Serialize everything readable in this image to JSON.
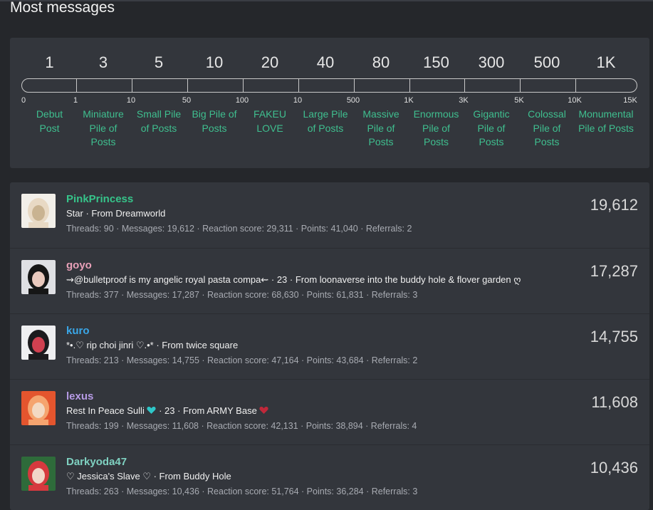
{
  "page": {
    "title": "Most messages"
  },
  "scale": {
    "levels": [
      "1",
      "3",
      "5",
      "10",
      "20",
      "40",
      "80",
      "150",
      "300",
      "500",
      "1K"
    ],
    "ticks": [
      "0",
      "1",
      "10",
      "50",
      "100",
      "10",
      "500",
      "1K",
      "3K",
      "5K",
      "10K",
      "15K"
    ],
    "trophies": [
      [
        "Debut",
        "Post"
      ],
      [
        "Miniature",
        "Pile of",
        "Posts"
      ],
      [
        "Small Pile",
        "of Posts"
      ],
      [
        "Big Pile of",
        "Posts"
      ],
      [
        "FAKEU",
        "LOVE"
      ],
      [
        "Large Pile",
        "of Posts"
      ],
      [
        "Massive",
        "Pile of",
        "Posts"
      ],
      [
        "Enormous",
        "Pile of",
        "Posts"
      ],
      [
        "Gigantic",
        "Pile of",
        "Posts"
      ],
      [
        "Colossal",
        "Pile of",
        "Posts"
      ],
      [
        "Monumental",
        "Pile of Posts"
      ]
    ],
    "trophy_color": "#3fbf8f"
  },
  "members": [
    {
      "name": "PinkPrincess",
      "name_color": "#36c48a",
      "title": "Star · From Dreamworld",
      "stats": "Threads: 90 · Messages: 19,612 · Reaction score: 29,311 · Points: 41,040 · Referrals: 2",
      "count": "19,612",
      "avatar_icon": "avatar-pinkprincess-icon",
      "avatar_colors": [
        "#f2efe9",
        "#e8d9c4",
        "#c9b391"
      ]
    },
    {
      "name": "goyo",
      "name_color": "#e8a0b8",
      "title": "⇝@bulletproof is my angelic royal pasta compa⇜ · 23 · From loonaverse into the buddy hole & flover garden ღ",
      "stats": "Threads: 377 · Messages: 17,287 · Reaction score: 68,630 · Points: 61,831 · Referrals: 3",
      "count": "17,287",
      "avatar_icon": "avatar-goyo-icon",
      "avatar_colors": [
        "#dfe0e4",
        "#161616",
        "#e9c9bd"
      ]
    },
    {
      "name": "kuro",
      "name_color": "#3aa7e8",
      "title": "*•.♡ rip choi jinri ♡.•* · From twice square",
      "stats": "Threads: 213 · Messages: 14,755 · Reaction score: 47,164 · Points: 43,684 · Referrals: 2",
      "count": "14,755",
      "avatar_icon": "avatar-kuro-icon",
      "avatar_colors": [
        "#efeff1",
        "#1c1b1e",
        "#d04050"
      ]
    },
    {
      "name": "lexus",
      "name_color": "#b79be6",
      "title_parts": [
        "Rest In Peace Sulli ",
        " · 23 · From ARMY Base "
      ],
      "title_hearts": [
        "#2ec7c9",
        "#c0283a"
      ],
      "stats": "Threads: 199 · Messages: 11,608 · Reaction score: 42,131 · Points: 38,894 · Referrals: 4",
      "count": "11,608",
      "avatar_icon": "avatar-lexus-icon",
      "avatar_colors": [
        "#e4552e",
        "#f5a46f",
        "#f3d9c3"
      ]
    },
    {
      "name": "Darkyoda47",
      "name_color": "#7fd1c1",
      "title": "♡ Jessica's Slave ♡ · From Buddy Hole",
      "stats": "Threads: 263 · Messages: 10,436 · Reaction score: 51,764 · Points: 36,284 · Referrals: 3",
      "count": "10,436",
      "avatar_icon": "avatar-darkyoda-icon",
      "avatar_colors": [
        "#2e6b3a",
        "#d6393e",
        "#f1d6c8"
      ]
    }
  ]
}
